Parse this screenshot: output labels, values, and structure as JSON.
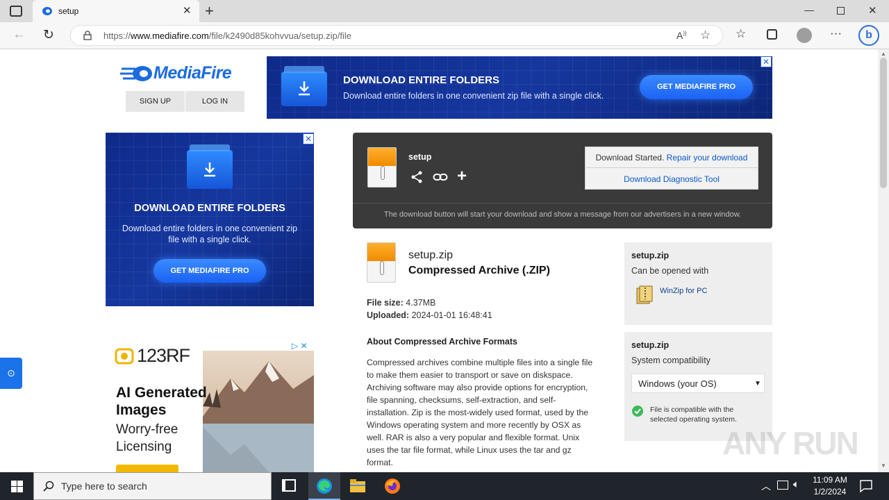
{
  "browser": {
    "tab_title": "setup",
    "url_prefix": "https://",
    "url_domain": "www.mediafire.com",
    "url_path": "/file/k2490d85kohvvua/setup.zip/file"
  },
  "header": {
    "logo_text": "MediaFire",
    "signup_label": "SIGN UP",
    "login_label": "LOG IN"
  },
  "top_ad": {
    "title": "DOWNLOAD ENTIRE FOLDERS",
    "subtitle": "Download entire folders in one convenient zip file with a single click.",
    "button_label": "GET MEDIAFIRE PRO",
    "close_label": "✕"
  },
  "side_ad": {
    "title": "DOWNLOAD ENTIRE FOLDERS",
    "subtitle": "Download entire folders in one convenient zip file with a single click.",
    "button_label": "GET MEDIAFIRE PRO",
    "close_label": "✕"
  },
  "rf_ad": {
    "brand": "123RF",
    "headline": "AI Generated Images",
    "tagline": "Worry-free Licensing"
  },
  "download_box": {
    "file_name": "setup",
    "status_text": "Download Started.",
    "repair_link": "Repair your download",
    "diagnostic_link": "Download Diagnostic Tool",
    "note": "The download button will start your download and show a message from our advertisers in a new window."
  },
  "file_info": {
    "name": "setup.zip",
    "type": "Compressed Archive (.ZIP)",
    "size_label": "File size:",
    "size_value": "4.37MB",
    "uploaded_label": "Uploaded:",
    "uploaded_value": "2024-01-01 16:48:41",
    "about_title": "About Compressed Archive Formats",
    "about_text": "Compressed archives combine multiple files into a single file to make them easier to transport or save on diskspace. Archiving software may also provide options for encryption, file spanning, checksums, self-extraction, and self-installation. Zip is the most-widely used format, used by the Windows operating system and more recently by OSX as well. RAR is also a very popular and flexible format. Unix uses the tar file format, while Linux uses the tar and gz format."
  },
  "open_with": {
    "file": "setup.zip",
    "caption": "Can be opened with",
    "app_label": "WinZip for PC"
  },
  "compat": {
    "file": "setup.zip",
    "caption": "System compatibility",
    "os_selected": "Windows (your OS)",
    "message": "File is compatible with the selected operating system."
  },
  "watermark": "ANY RUN",
  "taskbar": {
    "search_placeholder": "Type here to search",
    "time": "11:09 AM",
    "date": "1/2/2024"
  },
  "colors": {
    "mediafire_blue": "#1a6be0",
    "link_blue": "#0a58ca",
    "ad_navy": "#122f92",
    "dark_panel": "#3a3a3a"
  }
}
